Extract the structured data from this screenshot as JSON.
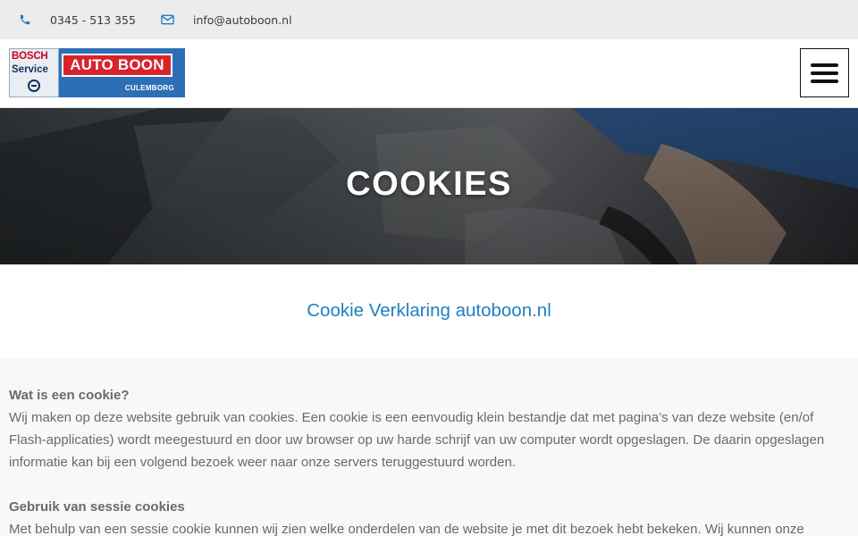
{
  "topbar": {
    "phone": "0345 - 513 355",
    "email": "info@autoboon.nl"
  },
  "logo": {
    "bosch_line1": "BOSCH",
    "bosch_line2": "Service",
    "brand": "AUTO BOON",
    "city": "CULEMBORG"
  },
  "hero": {
    "title": "COOKIES"
  },
  "intro": {
    "heading": "Cookie Verklaring autoboon.nl"
  },
  "content": {
    "sections": [
      {
        "heading": "Wat is een cookie?",
        "body": "Wij maken op deze website gebruik van cookies. Een cookie is een eenvoudig klein bestandje dat met pagina’s van deze website (en/of Flash-applicaties) wordt meegestuurd en door uw browser op uw harde schrijf van uw computer wordt opgeslagen. De daarin opgeslagen informatie kan bij een volgend bezoek weer naar onze servers teruggestuurd worden."
      },
      {
        "heading": "Gebruik van sessie cookies",
        "body": "Met behulp van een sessie cookie kunnen wij zien welke onderdelen van de website je met dit bezoek hebt bekeken. Wij kunnen onze"
      }
    ]
  },
  "colors": {
    "accent": "#1e7fc2",
    "topbar_bg": "#ececec",
    "logo_blue": "#2d6fb6",
    "logo_red": "#d8232a"
  },
  "icons": {
    "phone": "phone-icon",
    "email": "envelope-icon",
    "menu": "hamburger-menu-icon"
  }
}
